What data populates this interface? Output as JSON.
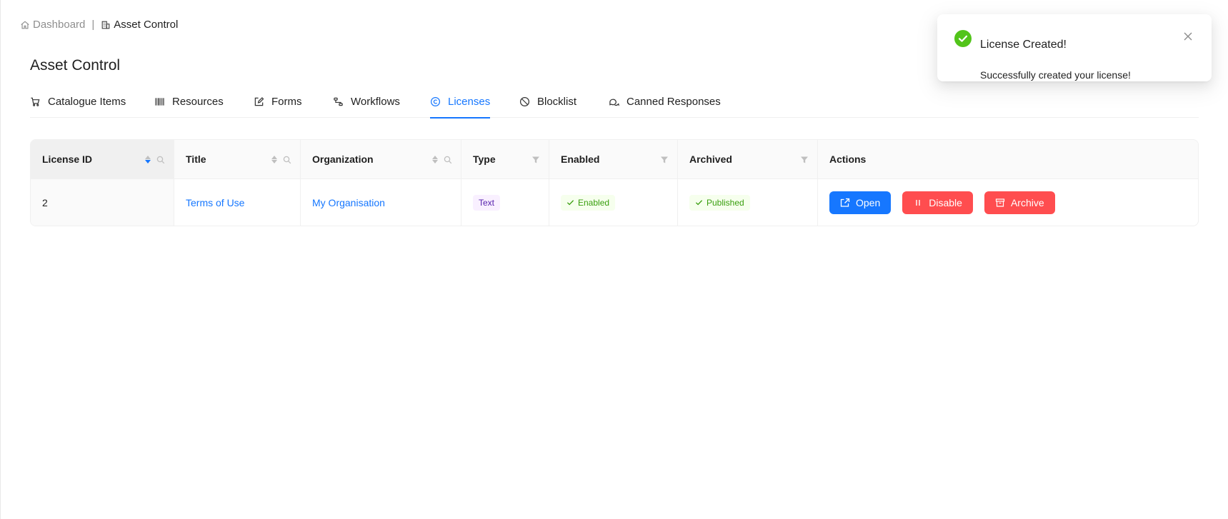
{
  "breadcrumb": {
    "items": [
      {
        "label": "Dashboard",
        "icon": "home-icon"
      },
      {
        "label": "Asset Control",
        "icon": "building-icon"
      }
    ],
    "separator": "|"
  },
  "page": {
    "title": "Asset Control"
  },
  "tabs": [
    {
      "label": "Catalogue Items",
      "icon": "cart-icon",
      "active": false
    },
    {
      "label": "Resources",
      "icon": "barcode-icon",
      "active": false
    },
    {
      "label": "Forms",
      "icon": "edit-icon",
      "active": false
    },
    {
      "label": "Workflows",
      "icon": "workflow-icon",
      "active": false
    },
    {
      "label": "Licenses",
      "icon": "copyright-icon",
      "active": true
    },
    {
      "label": "Blocklist",
      "icon": "stop-icon",
      "active": false
    },
    {
      "label": "Canned Responses",
      "icon": "comments-icon",
      "active": false
    }
  ],
  "table": {
    "columns": [
      {
        "label": "License ID",
        "sortable": true,
        "searchable": true,
        "sort": "descend"
      },
      {
        "label": "Title",
        "sortable": true,
        "searchable": true
      },
      {
        "label": "Organization",
        "sortable": true,
        "searchable": true
      },
      {
        "label": "Type",
        "filterable": true
      },
      {
        "label": "Enabled",
        "filterable": true
      },
      {
        "label": "Archived",
        "filterable": true
      },
      {
        "label": "Actions"
      }
    ],
    "rows": [
      {
        "license_id": "2",
        "title": "Terms of Use",
        "organization": "My Organisation",
        "type": "Text",
        "enabled": "Enabled",
        "archived": "Published",
        "actions": {
          "open": "Open",
          "disable": "Disable",
          "archive": "Archive"
        }
      }
    ]
  },
  "notification": {
    "title": "License Created!",
    "description": "Successfully created your license!",
    "icon": "check-circle-icon",
    "status": "success"
  },
  "colors": {
    "primary": "#1677ff",
    "danger": "#ff4d4f",
    "success": "#52c41a"
  }
}
